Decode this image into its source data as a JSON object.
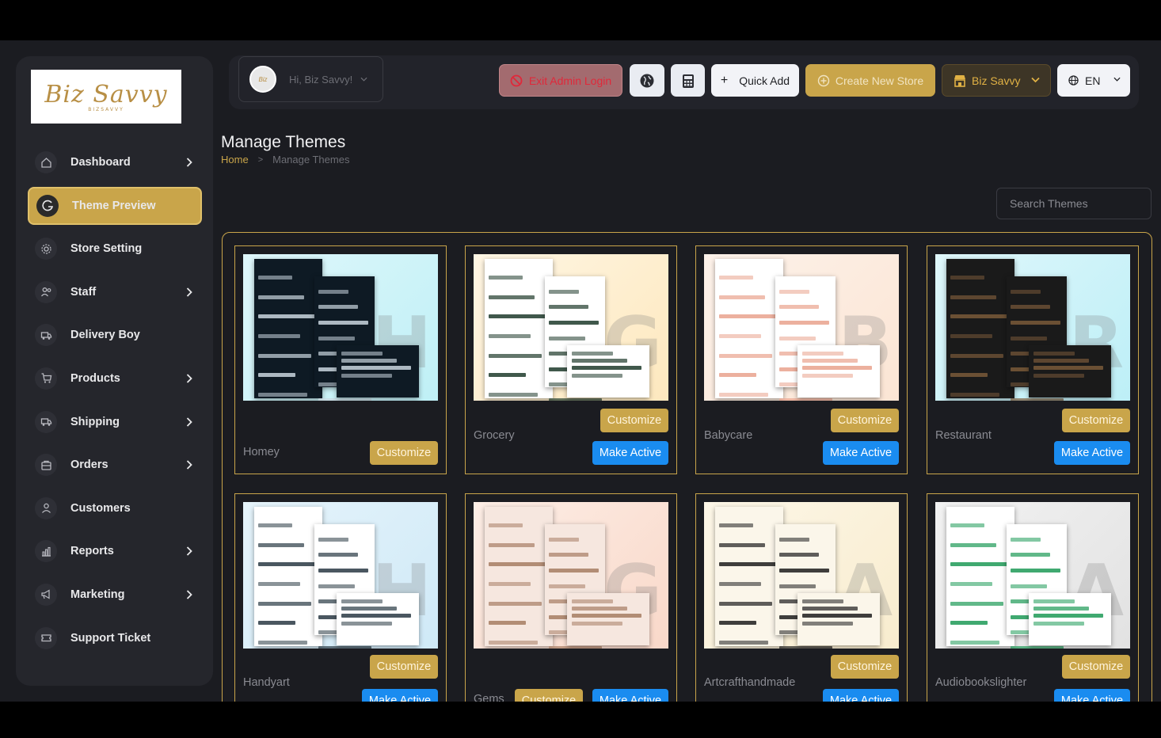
{
  "sidebar": {
    "logo_text": "Biz Savvy",
    "logo_sub": "BIZSAVVY",
    "items": [
      {
        "label": "Dashboard",
        "icon": "home-icon",
        "chevron": true
      },
      {
        "label": "Theme Preview",
        "icon": "theme-icon",
        "chevron": false,
        "active": true
      },
      {
        "label": "Store Setting",
        "icon": "gear-icon",
        "chevron": false
      },
      {
        "label": "Staff",
        "icon": "users-icon",
        "chevron": true
      },
      {
        "label": "Delivery Boy",
        "icon": "truck-icon",
        "chevron": false
      },
      {
        "label": "Products",
        "icon": "cart-icon",
        "chevron": true
      },
      {
        "label": "Shipping",
        "icon": "shipping-icon",
        "chevron": true
      },
      {
        "label": "Orders",
        "icon": "box-icon",
        "chevron": true
      },
      {
        "label": "Customers",
        "icon": "user-icon",
        "chevron": false
      },
      {
        "label": "Reports",
        "icon": "chart-icon",
        "chevron": true
      },
      {
        "label": "Marketing",
        "icon": "megaphone-icon",
        "chevron": true
      },
      {
        "label": "Support Ticket",
        "icon": "ticket-icon",
        "chevron": false
      }
    ]
  },
  "header": {
    "greeting": "Hi, Biz Savvy!",
    "exit_admin": "Exit Admin Login",
    "quick_add": "Quick Add",
    "create_store": "Create New Store",
    "store_name": "Biz Savvy",
    "language": "EN"
  },
  "page": {
    "title": "Manage Themes",
    "breadcrumb_home": "Home",
    "breadcrumb_current": "Manage Themes",
    "search_placeholder": "Search Themes"
  },
  "themes": [
    {
      "name": "Homey",
      "letter": "H",
      "bg": [
        "#dff7fb",
        "#bff0f6"
      ],
      "page_bg": "#0e1a24",
      "accent": "#c9d6de",
      "active": true
    },
    {
      "name": "Grocery",
      "letter": "G",
      "bg": [
        "#fff6e4",
        "#fde8be"
      ],
      "page_bg": "#ffffff",
      "accent": "#1f3b2b",
      "active": false
    },
    {
      "name": "Babycare",
      "letter": "B",
      "bg": [
        "#fdf2ea",
        "#fbe5d4"
      ],
      "page_bg": "#ffffff",
      "accent": "#e9a28d",
      "active": false
    },
    {
      "name": "Restaurant",
      "letter": "R",
      "bg": [
        "#dff7fb",
        "#bdeff7"
      ],
      "page_bg": "#1a1a1a",
      "accent": "#7a5a3a",
      "active": false
    },
    {
      "name": "Handyart",
      "letter": "H",
      "bg": [
        "#e6f4fb",
        "#cfe9f7"
      ],
      "page_bg": "#ffffff",
      "accent": "#2a3a44",
      "active": false
    },
    {
      "name": "Gems",
      "letter": "G",
      "bg": [
        "#fdeee6",
        "#f9d8c9"
      ],
      "page_bg": "#f6e7df",
      "accent": "#a67c63",
      "active": false
    },
    {
      "name": "Artcrafthandmade",
      "letter": "A",
      "bg": [
        "#fdf7e8",
        "#f8ecce"
      ],
      "page_bg": "#fbf6ea",
      "accent": "#1d1d1d",
      "active": false
    },
    {
      "name": "Audiobookslighter",
      "letter": "A",
      "bg": [
        "#f2f2f2",
        "#e2e2e2"
      ],
      "page_bg": "#ffffff",
      "accent": "#1e9a57",
      "active": false
    }
  ],
  "buttons": {
    "customize": "Customize",
    "make_active": "Make Active"
  },
  "colors": {
    "gold": "#c9a54a",
    "blue": "#1a8cf0",
    "panel": "#25262c",
    "bg": "#1b1c21"
  }
}
